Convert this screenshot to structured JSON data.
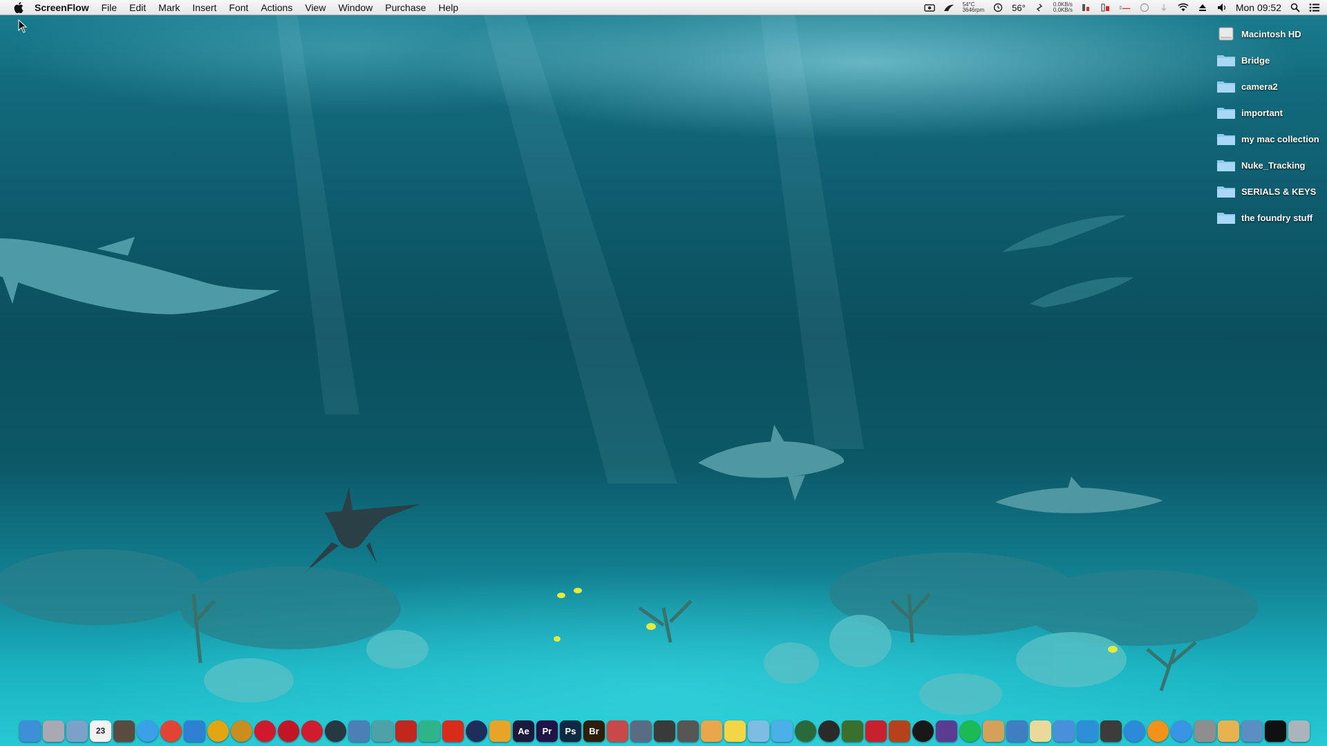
{
  "menubar": {
    "apple_icon": "apple-icon",
    "app_name": "ScreenFlow",
    "menus": [
      "File",
      "Edit",
      "Mark",
      "Insert",
      "Font",
      "Actions",
      "View",
      "Window",
      "Purchase",
      "Help"
    ],
    "status": {
      "temp_top": "54°C",
      "temp_bottom": "3646rpm",
      "degrees": "56°",
      "net_up": "0.0KB/s",
      "net_down": "0.0KB/s",
      "clock": "Mon 09:52"
    }
  },
  "desktop_icons": [
    {
      "label": "Macintosh HD",
      "icon": "hard-drive-icon"
    },
    {
      "label": "Bridge",
      "icon": "folder-icon"
    },
    {
      "label": "camera2",
      "icon": "folder-icon"
    },
    {
      "label": "important",
      "icon": "folder-icon"
    },
    {
      "label": "my mac collection",
      "icon": "folder-icon"
    },
    {
      "label": "Nuke_Tracking",
      "icon": "folder-icon"
    },
    {
      "label": "SERIALS & KEYS",
      "icon": "folder-icon"
    },
    {
      "label": "the foundry stuff",
      "icon": "folder-icon"
    }
  ],
  "dock": [
    {
      "name": "finder",
      "text": "",
      "color": "#3d8fd6"
    },
    {
      "name": "launchpad",
      "text": "",
      "color": "#a9a9b4"
    },
    {
      "name": "preview",
      "text": "",
      "color": "#7aa2c8"
    },
    {
      "name": "calendar",
      "text": "23",
      "color": "#f2f2f2"
    },
    {
      "name": "photo-booth",
      "text": "",
      "color": "#5a4b40"
    },
    {
      "name": "safari",
      "text": "",
      "color": "#3aa0e8"
    },
    {
      "name": "chrome",
      "text": "",
      "color": "#e34234"
    },
    {
      "name": "network-app",
      "text": "",
      "color": "#2f7fd3"
    },
    {
      "name": "sun-app",
      "text": "",
      "color": "#e3a512"
    },
    {
      "name": "app-circle",
      "text": "",
      "color": "#c98e1d"
    },
    {
      "name": "red-app-1",
      "text": "",
      "color": "#d0192c"
    },
    {
      "name": "red-app-2",
      "text": "",
      "color": "#c21627"
    },
    {
      "name": "red-app-3",
      "text": "",
      "color": "#d01c2e"
    },
    {
      "name": "nuke",
      "text": "",
      "color": "#273842"
    },
    {
      "name": "transform-app",
      "text": "",
      "color": "#4a80b5"
    },
    {
      "name": "mocha",
      "text": "",
      "color": "#4fa1a8"
    },
    {
      "name": "acrobat",
      "text": "",
      "color": "#c2261d"
    },
    {
      "name": "tool-app",
      "text": "",
      "color": "#2fb388"
    },
    {
      "name": "adobe-app",
      "text": "",
      "color": "#d92a1c"
    },
    {
      "name": "cinema-app",
      "text": "",
      "color": "#1d2e5d"
    },
    {
      "name": "pencil-app",
      "text": "",
      "color": "#e8a329"
    },
    {
      "name": "after-effects",
      "text": "Ae",
      "color": "#1b1a3e"
    },
    {
      "name": "premiere",
      "text": "Pr",
      "color": "#1f1348"
    },
    {
      "name": "photoshop",
      "text": "Ps",
      "color": "#0d2a42"
    },
    {
      "name": "bridge",
      "text": "Br",
      "color": "#2d1f0c"
    },
    {
      "name": "screenflow",
      "text": "",
      "color": "#c94848"
    },
    {
      "name": "motion",
      "text": "",
      "color": "#5a6b84"
    },
    {
      "name": "final-cut",
      "text": "",
      "color": "#3a3a3a"
    },
    {
      "name": "compressor",
      "text": "",
      "color": "#565656"
    },
    {
      "name": "pages",
      "text": "",
      "color": "#e9a64a"
    },
    {
      "name": "notes",
      "text": "",
      "color": "#f3d545"
    },
    {
      "name": "keynote",
      "text": "",
      "color": "#7dbde3"
    },
    {
      "name": "messages",
      "text": "",
      "color": "#4cb0e8"
    },
    {
      "name": "facetime",
      "text": "",
      "color": "#2a6a3a"
    },
    {
      "name": "aperture",
      "text": "",
      "color": "#2a2a2a"
    },
    {
      "name": "iphoto",
      "text": "",
      "color": "#3b6f2d"
    },
    {
      "name": "red-folder",
      "text": "",
      "color": "#c6212c"
    },
    {
      "name": "fantasy-app",
      "text": "",
      "color": "#b7411b"
    },
    {
      "name": "black-app",
      "text": "",
      "color": "#181818"
    },
    {
      "name": "imovie",
      "text": "",
      "color": "#5a3c92"
    },
    {
      "name": "spotify",
      "text": "",
      "color": "#1db954"
    },
    {
      "name": "hedgehog-app",
      "text": "",
      "color": "#d4a15a"
    },
    {
      "name": "xcode",
      "text": "",
      "color": "#3f7ec3"
    },
    {
      "name": "textedit",
      "text": "",
      "color": "#e9d99a"
    },
    {
      "name": "chart-app",
      "text": "",
      "color": "#4a8fdb"
    },
    {
      "name": "stand-app",
      "text": "",
      "color": "#2d8fd8"
    },
    {
      "name": "clapper-app",
      "text": "",
      "color": "#3c3c3c"
    },
    {
      "name": "itunes",
      "text": "",
      "color": "#2d8ad8"
    },
    {
      "name": "vlc",
      "text": "",
      "color": "#f39218"
    },
    {
      "name": "app-store",
      "text": "",
      "color": "#3a94e6"
    },
    {
      "name": "system-app",
      "text": "",
      "color": "#8e8e8e"
    },
    {
      "name": "folder-app",
      "text": "",
      "color": "#e8b251"
    },
    {
      "name": "downloads",
      "text": "",
      "color": "#5a8fc4"
    },
    {
      "name": "terminal",
      "text": "",
      "color": "#101010"
    },
    {
      "name": "trash",
      "text": "",
      "color": "#a9b4bb"
    }
  ]
}
